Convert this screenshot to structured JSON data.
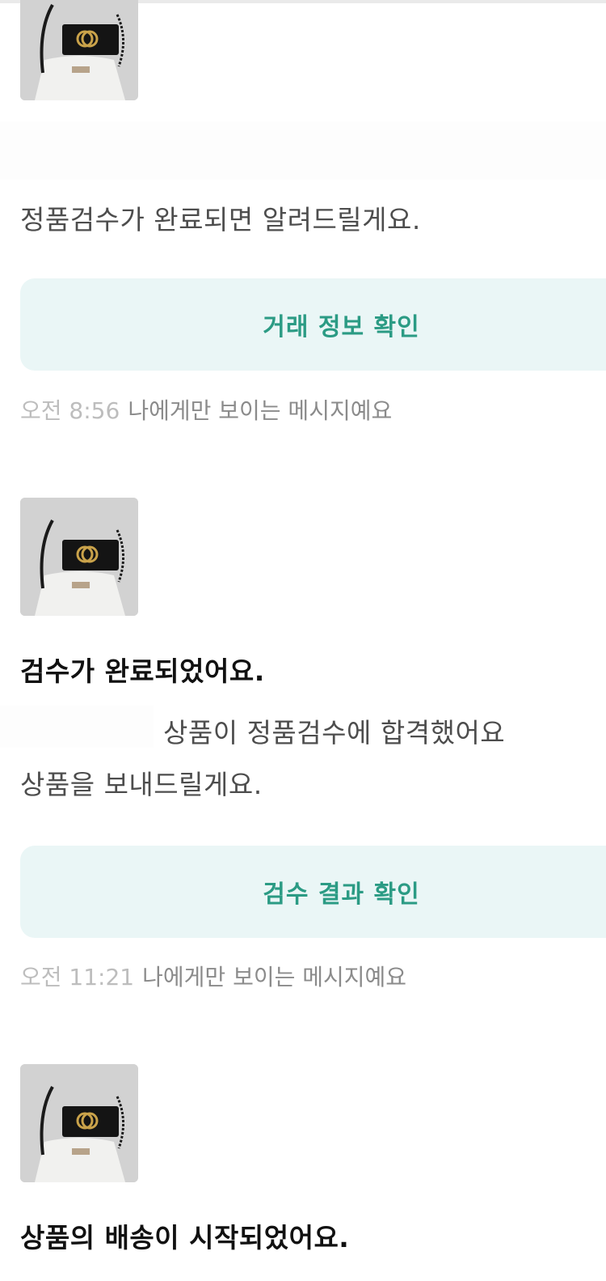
{
  "messages": [
    {
      "thumbnail_icon": "handbag-product-image",
      "body_line1": "정품검수가 완료되면 알려드릴게요.",
      "button_label": "거래 정보 확인",
      "time": "오전 8:56",
      "visibility_note": "나에게만 보이는 메시지예요"
    },
    {
      "thumbnail_icon": "handbag-product-image",
      "title": "검수가 완료되었어요.",
      "body_line1": "상품이 정품검수에 합격했어요",
      "body_line2": "상품을 보내드릴게요.",
      "button_label": "검수 결과 확인",
      "time": "오전 11:21",
      "visibility_note": "나에게만 보이는 메시지예요"
    },
    {
      "thumbnail_icon": "handbag-product-image",
      "title": "상품의 배송이 시작되었어요."
    }
  ],
  "colors": {
    "button_bg": "#eaf6f6",
    "button_text": "#2b9b84",
    "time_text": "#bdbdbd",
    "note_text": "#8b8b8b"
  }
}
